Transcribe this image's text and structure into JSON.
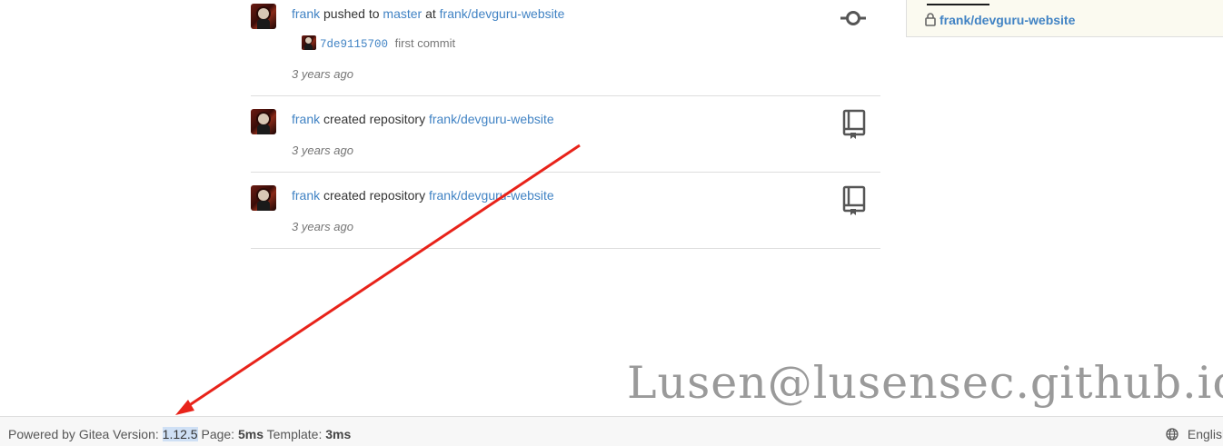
{
  "feed": {
    "items": [
      {
        "user": "frank",
        "action": "pushed to",
        "branch": "master",
        "connector": "at",
        "repo": "frank/devguru-website",
        "commit": {
          "sha": "7de9115700",
          "message": "first commit"
        },
        "time": "3 years ago",
        "icon": "git-commit-icon"
      },
      {
        "user": "frank",
        "action": "created repository",
        "repo": "frank/devguru-website",
        "time": "3 years ago",
        "icon": "repo-book-icon"
      },
      {
        "user": "frank",
        "action": "created repository",
        "repo": "frank/devguru-website",
        "time": "3 years ago",
        "icon": "repo-book-icon"
      }
    ]
  },
  "sidebar": {
    "repos": [
      {
        "name": "frank/devguru-website",
        "icon": "lock-icon"
      }
    ]
  },
  "watermark": "Lusen@lusensec.github.io",
  "footer": {
    "powered_by": "Powered by Gitea Version:",
    "version": "1.12.5",
    "page_label": "Page:",
    "page_time": "5ms",
    "template_label": "Template:",
    "template_time": "3ms",
    "language": "English",
    "language_icon": "globe-icon"
  },
  "colors": {
    "link": "#4183c4",
    "annotation_arrow": "#e8231a",
    "version_highlight": "#cfe0f5"
  }
}
